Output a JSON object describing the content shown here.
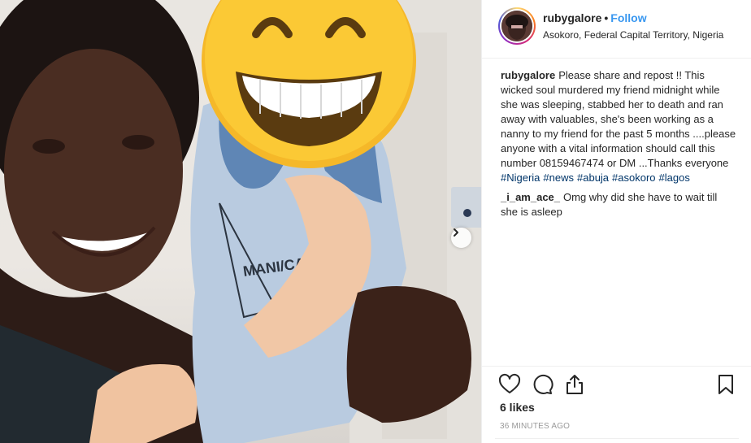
{
  "post": {
    "username": "rubygalore",
    "dot": "•",
    "follow_label": "Follow",
    "location": "Asokoro, Federal Capital Territory, Nigeria",
    "caption_user": "rubygalore",
    "caption_text": "Please share and repost !! This wicked soul murdered my friend midnight while she was sleeping, stabbed her to death and ran away with valuables, she's been working as a nanny to my friend for the past 5 months ....please anyone with a vital information should call this number 08159467474 or DM ...Thanks everyone",
    "hashtags": [
      "#Nigeria",
      "#news",
      "#abuja",
      "#asokoro",
      "#lagos"
    ],
    "comment_user": "_i_am_ace_",
    "comment_text": "Omg why did she have to wait till she is asleep",
    "likes": "6 likes",
    "time_ago": "36 MINUTES AGO"
  },
  "photo": {
    "shirt_text": "MANI/CALI+",
    "emoji": "grinning-face-with-smiling-eyes-emoji"
  },
  "colors": {
    "link_blue": "#3897f0",
    "hashtag_blue": "#003569",
    "border": "#efefef"
  },
  "icons": {
    "like": "heart-icon",
    "comment": "comment-bubble-icon",
    "share": "share-icon",
    "save": "bookmark-icon",
    "carousel": "chevron-right-icon"
  }
}
